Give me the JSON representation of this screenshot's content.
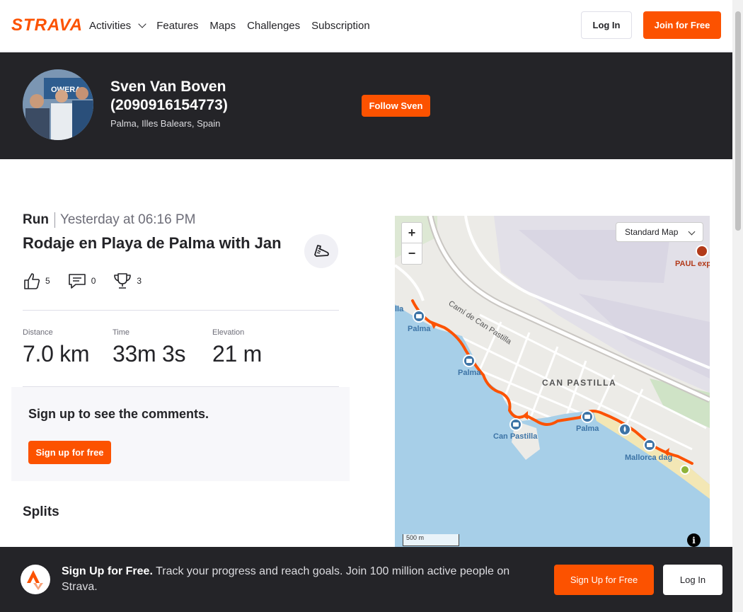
{
  "nav": {
    "logo": "STRAVA",
    "links": [
      "Activities",
      "Features",
      "Maps",
      "Challenges",
      "Subscription"
    ],
    "login": "Log In",
    "join": "Join for Free"
  },
  "athlete": {
    "name": "Sven Van Boven (2090916154773)",
    "location": "Palma, Illes Balears, Spain",
    "follow": "Follow Sven"
  },
  "activity": {
    "type": "Run",
    "time": "Yesterday at 06:16 PM",
    "title": "Rodaje en Playa de Palma with Jan",
    "kudos": "5",
    "comments": "0",
    "achievements": "3",
    "stats": [
      {
        "label": "Distance",
        "value": "7.0 km"
      },
      {
        "label": "Time",
        "value": "33m 3s"
      },
      {
        "label": "Elevation",
        "value": "21 m"
      }
    ]
  },
  "comments": {
    "title": "Sign up to see the comments.",
    "button": "Sign up for free"
  },
  "splits": {
    "title": "Splits"
  },
  "map": {
    "style": "Standard Map",
    "zoom_in": "+",
    "zoom_out": "−",
    "scale": "500 m",
    "info": "i",
    "labels": {
      "palma1": "Palma",
      "palma_left": "lla",
      "palma2": "Palma",
      "palma3": "Palma",
      "can_pastilla": "Can Pastilla",
      "can_pastilla_area": "CAN PASTILLA",
      "street": "Camí de Can Pastilla",
      "mallorca": "Mallorca dag",
      "paul": "PAUL exp"
    }
  },
  "signup_bar": {
    "bold": "Sign Up for Free.",
    "text": "Track your progress and reach goals. Join 100 million active people on Strava.",
    "signup": "Sign Up for Free",
    "login": "Log In"
  },
  "colors": {
    "brand": "#fc5200",
    "dark": "#242428",
    "route": "#fc5200"
  }
}
